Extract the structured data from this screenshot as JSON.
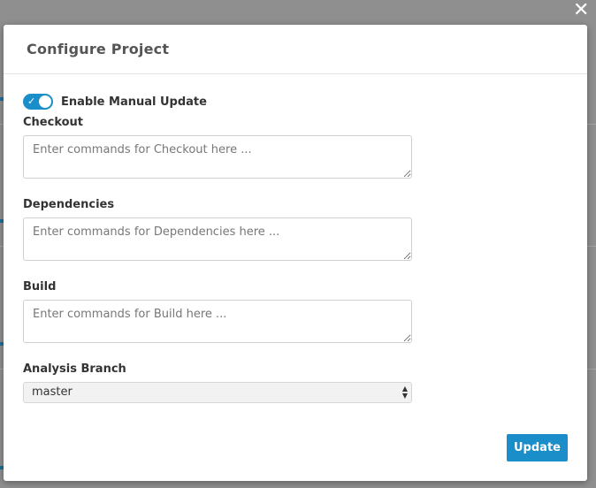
{
  "dialog": {
    "title": "Configure Project",
    "close_glyph": "✕"
  },
  "manual_update": {
    "label": "Enable Manual Update",
    "enabled": true
  },
  "fields": [
    {
      "label": "Checkout",
      "placeholder": "Enter commands for Checkout here ...",
      "value": ""
    },
    {
      "label": "Dependencies",
      "placeholder": "Enter commands for Dependencies here ...",
      "value": ""
    },
    {
      "label": "Build",
      "placeholder": "Enter commands for Build here ...",
      "value": ""
    }
  ],
  "analysis_branch": {
    "label": "Analysis Branch",
    "selected": "master"
  },
  "footer": {
    "update_label": "Update"
  },
  "colors": {
    "accent": "#1a8ec9",
    "overlay": "#8f8f8f"
  },
  "icons": {
    "close": "close-icon",
    "toggle_check": "check-icon",
    "select_arrows": "select-arrows-icon"
  }
}
